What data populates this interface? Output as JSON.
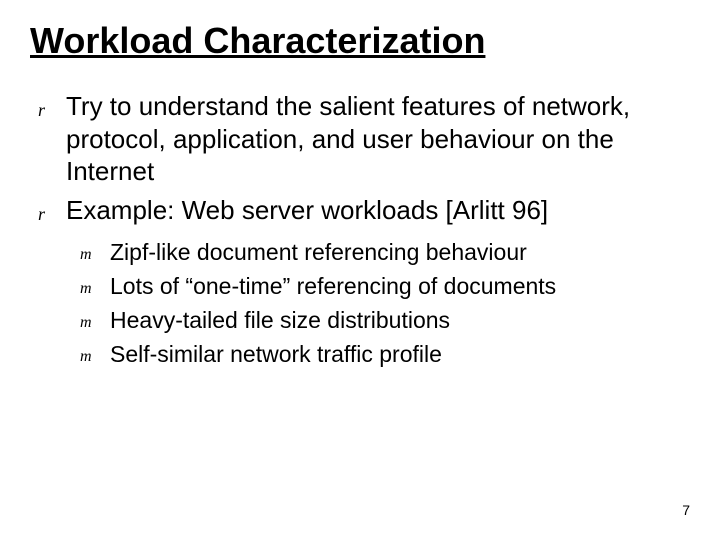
{
  "title": "Workload Characterization",
  "bullets": [
    {
      "marker": "r",
      "text": "Try to understand the salient features of network, protocol, application, and user behaviour on the Internet"
    },
    {
      "marker": "r",
      "text": "Example: Web server workloads [Arlitt 96]"
    }
  ],
  "subbullets": [
    {
      "marker": "m",
      "text": "Zipf-like document referencing behaviour"
    },
    {
      "marker": "m",
      "text": "Lots of “one-time” referencing of documents"
    },
    {
      "marker": "m",
      "text": "Heavy-tailed file size distributions"
    },
    {
      "marker": "m",
      "text": "Self-similar network traffic profile"
    }
  ],
  "page_number": "7"
}
